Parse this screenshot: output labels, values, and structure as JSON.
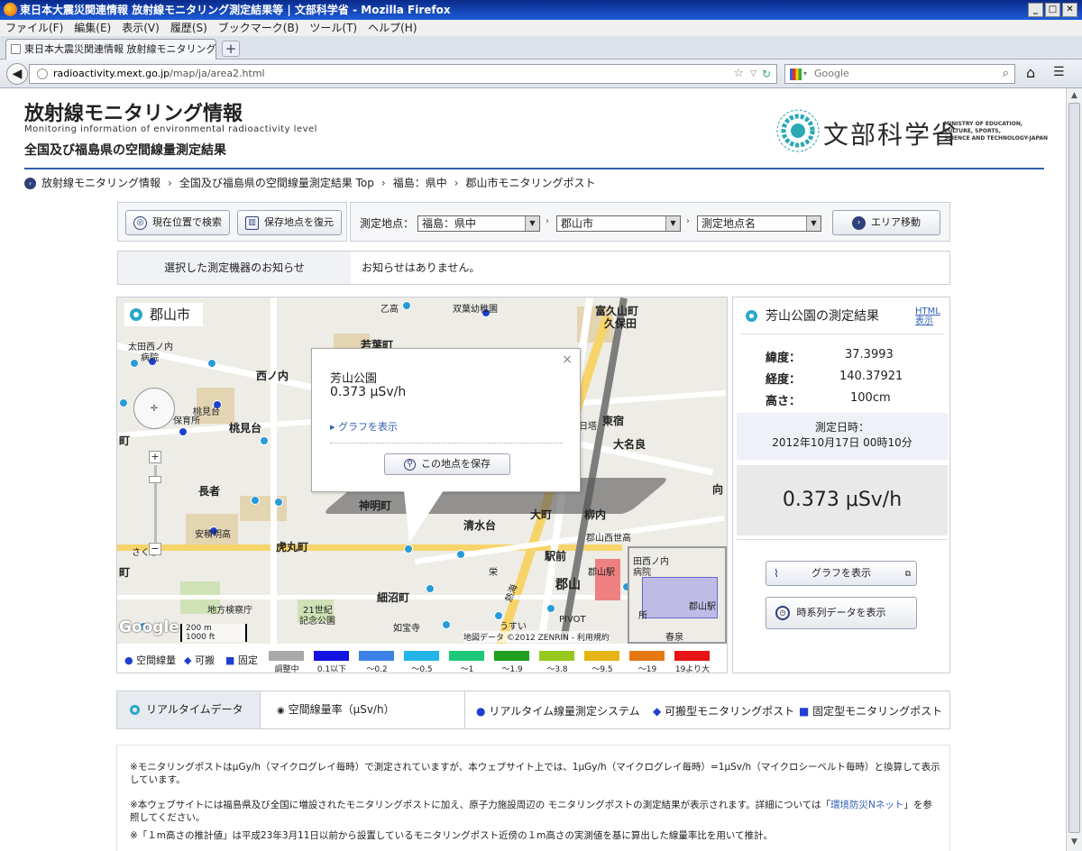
{
  "window": {
    "title": "東日本大震災関連情報 放射線モニタリング測定結果等 | 文部科学省 - Mozilla Firefox"
  },
  "menu": [
    "ファイル(F)",
    "編集(E)",
    "表示(V)",
    "履歴(S)",
    "ブックマーク(B)",
    "ツール(T)",
    "ヘルプ(H)"
  ],
  "tab": {
    "label": "東日本大震災関連情報 放射線モニタリング...",
    "new": "+"
  },
  "nav": {
    "url_host": "radioactivity.mext.go.jp",
    "url_path": "/map/ja/area2.html",
    "search_placeholder": "Google"
  },
  "header": {
    "title": "放射線モニタリング情報",
    "subtitle": "Monitoring information of environmental radioactivity level",
    "subtitle2": "全国及び福島県の空間線量測定結果",
    "logo_jp": "文部科学省",
    "logo_en": [
      "MINISTRY OF EDUCATION,",
      "CULTURE, SPORTS,",
      "SCIENCE AND TECHNOLOGY-JAPAN"
    ]
  },
  "breadcrumb": [
    "放射線モニタリング情報",
    "全国及び福島県の空間線量測定結果 Top",
    "福島：県中",
    "郡山市モニタリングポスト"
  ],
  "controls": {
    "locate": "現在位置で検索",
    "restore": "保存地点を復元",
    "point_label": "測定地点：",
    "pref": "福島：県中",
    "city": "郡山市",
    "station": "測定地点名",
    "area_move": "エリア移動"
  },
  "notice": {
    "label": "選択した測定機器のお知らせ",
    "text": "お知らせはありません。"
  },
  "map": {
    "area": "郡山市",
    "popup_name": "芳山公園",
    "popup_value": "0.373 μSv/h",
    "popup_graph": "グラフを表示",
    "popup_save": "この地点を保存",
    "scale_m": "200 m",
    "scale_ft": "1000 ft",
    "copyright": "地図データ ©2012 ZENRIN - 利用規約",
    "google": "Google",
    "labels": [
      "乙高",
      "双葉幼稚園",
      "富久山町",
      "久保田",
      "若葉町",
      "西ノ内",
      "太田西ノ内",
      "病院",
      "桃見台",
      "桃見台",
      "保育所",
      "長者",
      "安積明高",
      "東宿",
      "大名良",
      "日塔",
      "神明町",
      "清水台",
      "大町",
      "柳内",
      "虎丸町",
      "駅前",
      "郡山",
      "郡山駅",
      "細沼町",
      "21世紀",
      "記念公園",
      "地方検察庁",
      "如宝寺",
      "うすい",
      "PIVOT",
      "向",
      "町",
      "町",
      "さくら",
      "栄",
      "熱海",
      "郡山西世高",
      "田西ノ内",
      "病院",
      "郡山駅",
      "所",
      "春泉"
    ]
  },
  "legend": {
    "types": [
      "空間線量",
      "可搬",
      "固定"
    ],
    "ranges": [
      "調整中",
      "0.1以下",
      "～0.2",
      "～0.5",
      "～1",
      "～1.9",
      "～3.8",
      "～9.5",
      "～19",
      "19より大"
    ],
    "colors": [
      "#a9a9a9",
      "#1414e0",
      "#3c82e6",
      "#23b4e6",
      "#1ec878",
      "#1e9e1e",
      "#96c81e",
      "#e6b414",
      "#e67814",
      "#e61414"
    ]
  },
  "result": {
    "title": "芳山公園の測定結果",
    "html_link": "HTML表示",
    "lat_label": "緯度：",
    "lat": "37.3993",
    "lon_label": "経度：",
    "lon": "140.37921",
    "alt_label": "高さ：",
    "alt": "100cm",
    "date_label": "測定日時：",
    "date": "2012年10月17日 00時10分",
    "value": "0.373 μSv/h",
    "graph_btn": "グラフを表示",
    "series_btn": "時系列データを表示"
  },
  "bottombar": {
    "realtime": "リアルタイムデータ",
    "unit": "空間線量率（μSv/h）",
    "sys": "リアルタイム線量測定システム",
    "portable": "可搬型モニタリングポスト",
    "fixed": "固定型モニタリングポスト"
  },
  "notes": [
    "※モニタリングポストはμGy/h（マイクログレイ毎時）で測定されていますが、本ウェブサイト上では、1μGy/h（マイクログレイ毎時）=1μSv/h（マイクロシーベルト毎時）と換算して表示しています。",
    "※本ウェブサイトには福島県及び全国に増設されたモニタリングポストに加え、原子力施設周辺の モニタリングポストの測定結果が表示されます。詳細については「",
    "環境防災Nネット",
    "」を参照してください。",
    "※「１m高さの推計値」は平成23年3月11日以前から設置しているモニタリングポスト近傍の１m高さの実測値を基に算出した線量率比を用いて推計。"
  ]
}
